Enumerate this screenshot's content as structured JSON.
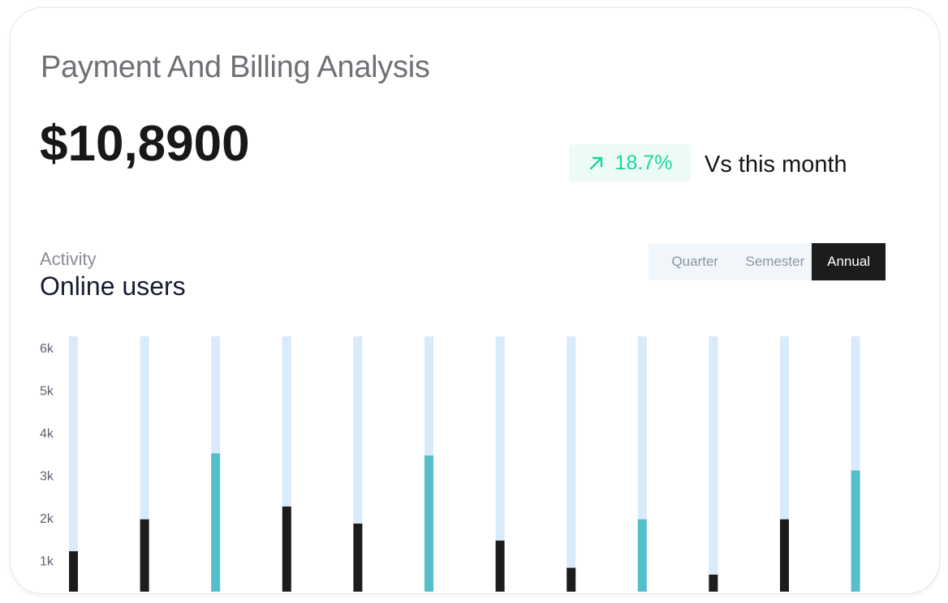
{
  "header": {
    "title": "Payment And Billing Analysis",
    "amount": "$10,8900",
    "change": "18.7%",
    "change_icon": "arrow-up-right-icon",
    "comparison_text": "Vs this month"
  },
  "activity": {
    "label": "Activity",
    "title": "Online users"
  },
  "period_tabs": [
    {
      "label": "Quarter",
      "active": false
    },
    {
      "label": "Semester",
      "active": false
    },
    {
      "label": "Annual",
      "active": true
    }
  ],
  "colors": {
    "track": "#d9eafb",
    "bar_dark": "#1c1c1c",
    "bar_teal": "#54bfcb",
    "change_green": "#1fd4a2"
  },
  "chart_data": {
    "type": "bar",
    "y_ticks": [
      "6k",
      "5k",
      "4k",
      "3k",
      "2k",
      "1k"
    ],
    "y_tick_values": [
      6000,
      5000,
      4000,
      3000,
      2000,
      1000
    ],
    "ylim": [
      0,
      6000
    ],
    "track_max": 6000,
    "values": [
      950,
      1700,
      3250,
      2000,
      1600,
      3200,
      1200,
      560,
      1700,
      400,
      1700,
      2850
    ],
    "highlight": [
      false,
      false,
      true,
      false,
      false,
      true,
      false,
      false,
      true,
      false,
      false,
      true
    ]
  }
}
